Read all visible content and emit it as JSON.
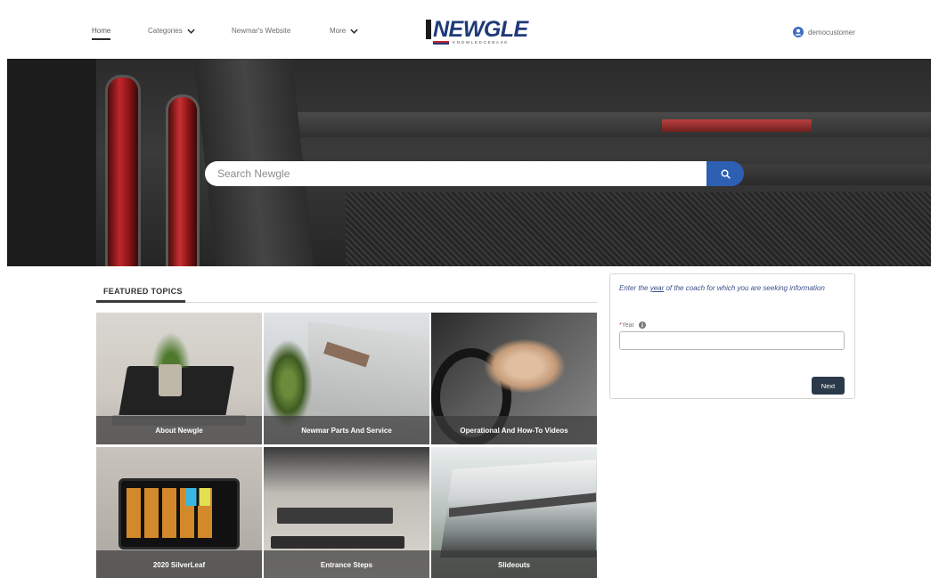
{
  "header": {
    "nav": [
      {
        "label": "Home",
        "active": true
      },
      {
        "label": "Categories",
        "dropdown": true
      },
      {
        "label": "Newmar's Website"
      },
      {
        "label": "More",
        "dropdown": true
      }
    ],
    "logo": {
      "main": "NEWGLE",
      "sub": "KNOWLEDGEBASE"
    },
    "user": {
      "name": "democustomer",
      "icon": "user-circle-icon"
    }
  },
  "search": {
    "placeholder": "Search Newgle",
    "icon": "search-icon",
    "button_color": "#2d5fb3"
  },
  "featured": {
    "title": "FEATURED TOPICS",
    "tiles": [
      {
        "label": "About Newgle"
      },
      {
        "label": "Newmar Parts And Service"
      },
      {
        "label": "Operational And How-To Videos"
      },
      {
        "label": "2020 SilverLeaf"
      },
      {
        "label": "Entrance Steps"
      },
      {
        "label": "Slideouts"
      }
    ]
  },
  "year_form": {
    "message_prefix": "Enter the ",
    "message_emphasis": "year",
    "message_suffix": " of the coach for which you are seeking information",
    "required_mark": "*",
    "field_label": "Year",
    "field_value": "",
    "next_label": "Next",
    "info_icon": "info-icon"
  },
  "colors": {
    "accent": "#2d5fb3",
    "text_link": "#3b4f8a",
    "button_dark": "#2b3a4a"
  }
}
